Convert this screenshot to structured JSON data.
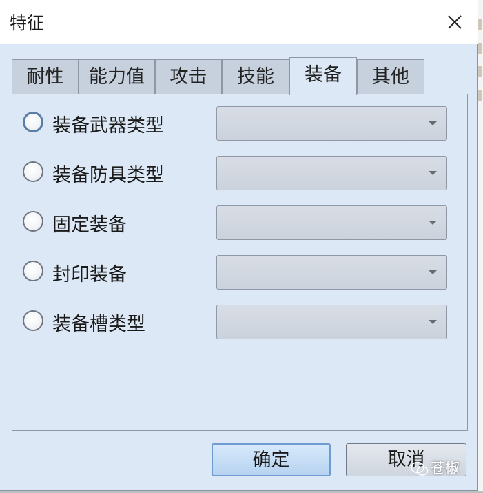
{
  "window": {
    "title": "特征",
    "close_icon": "close-icon"
  },
  "tabs": [
    {
      "label": "耐性",
      "active": false
    },
    {
      "label": "能力值",
      "active": false
    },
    {
      "label": "攻击",
      "active": false
    },
    {
      "label": "技能",
      "active": false
    },
    {
      "label": "装备",
      "active": true
    },
    {
      "label": "其他",
      "active": false
    }
  ],
  "options": [
    {
      "label": "装备武器类型",
      "selected": false,
      "value": ""
    },
    {
      "label": "装备防具类型",
      "selected": false,
      "value": ""
    },
    {
      "label": "固定装备",
      "selected": false,
      "value": ""
    },
    {
      "label": "封印装备",
      "selected": false,
      "value": ""
    },
    {
      "label": "装备槽类型",
      "selected": false,
      "value": ""
    }
  ],
  "buttons": {
    "ok": "确定",
    "cancel": "取消"
  },
  "watermark": {
    "text": "苍椒",
    "icon": "wechat-icon"
  },
  "colors": {
    "dialog_bg": "#dde8f6",
    "tab_inactive": "#c7d1de",
    "ok_accent": "#6e9bd0"
  }
}
